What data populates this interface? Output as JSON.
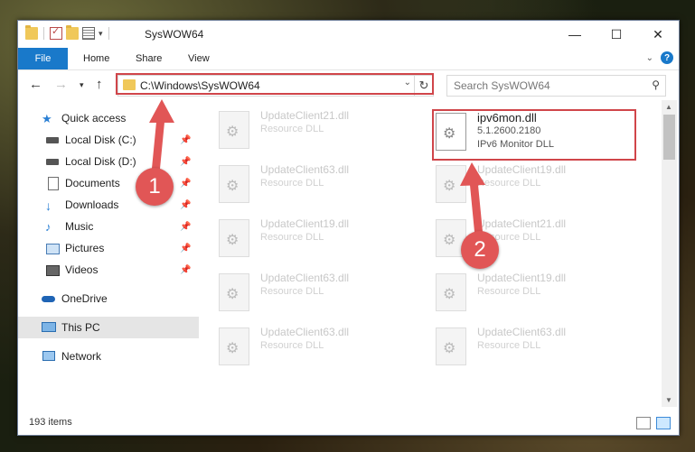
{
  "window": {
    "title": "SysWOW64"
  },
  "ribbon": {
    "tabs": [
      "File",
      "Home",
      "Share",
      "View"
    ]
  },
  "address": {
    "path": "C:\\Windows\\SysWOW64"
  },
  "search": {
    "placeholder": "Search SysWOW64"
  },
  "sidebar": {
    "items": [
      {
        "label": "Quick access"
      },
      {
        "label": "Local Disk (C:)"
      },
      {
        "label": "Local Disk (D:)"
      },
      {
        "label": "Documents"
      },
      {
        "label": "Downloads"
      },
      {
        "label": "Music"
      },
      {
        "label": "Pictures"
      },
      {
        "label": "Videos"
      },
      {
        "label": "OneDrive"
      },
      {
        "label": "This PC"
      },
      {
        "label": "Network"
      }
    ]
  },
  "files": {
    "highlighted": {
      "name": "ipv6mon.dll",
      "version": "5.1.2600.2180",
      "desc": "IPv6 Monitor DLL"
    },
    "left": [
      {
        "name": "UpdateClient21.dll",
        "desc": "Resource DLL"
      },
      {
        "name": "UpdateClient63.dll",
        "desc": "Resource DLL"
      },
      {
        "name": "UpdateClient19.dll",
        "desc": "Resource DLL"
      },
      {
        "name": "UpdateClient63.dll",
        "desc": "Resource DLL"
      },
      {
        "name": "UpdateClient63.dll",
        "desc": "Resource DLL"
      }
    ],
    "right": [
      {
        "name": "UpdateClient19.dll",
        "desc": "Resource DLL"
      },
      {
        "name": "UpdateClient21.dll",
        "desc": "Resource DLL"
      },
      {
        "name": "UpdateClient19.dll",
        "desc": "Resource DLL"
      },
      {
        "name": "UpdateClient63.dll",
        "desc": "Resource DLL"
      }
    ]
  },
  "status": {
    "items_count": "193 items"
  },
  "annotations": {
    "step1": "1",
    "step2": "2",
    "color": "#e15656"
  }
}
